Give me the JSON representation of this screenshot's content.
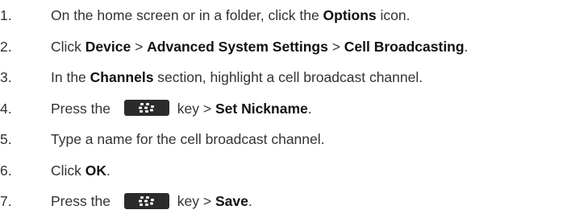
{
  "steps": [
    {
      "number": "1.",
      "parts": [
        "On the home screen or in a folder, click the ",
        "Options",
        " icon."
      ]
    },
    {
      "number": "2.",
      "parts": [
        "Click ",
        "Device",
        " > ",
        "Advanced System Settings",
        " > ",
        "Cell Broadcasting",
        "."
      ]
    },
    {
      "number": "3.",
      "parts": [
        "In the ",
        "Channels",
        " section, highlight a cell broadcast channel."
      ]
    },
    {
      "number": "4.",
      "parts": [
        "Press the ",
        "key > ",
        "Set Nickname",
        "."
      ],
      "icon": "blackberry-menu-key-icon"
    },
    {
      "number": "5.",
      "parts": [
        "Type a name for the cell broadcast channel."
      ]
    },
    {
      "number": "6.",
      "parts": [
        "Click ",
        "OK",
        "."
      ]
    },
    {
      "number": "7.",
      "parts": [
        "Press the ",
        "key > ",
        "Save",
        "."
      ],
      "icon": "blackberry-menu-key-icon"
    }
  ],
  "colors": {
    "text": "#333333",
    "bold_text": "#111111",
    "menu_key_bg": "#2b2b2b",
    "menu_key_glyph": "#ffffff"
  }
}
